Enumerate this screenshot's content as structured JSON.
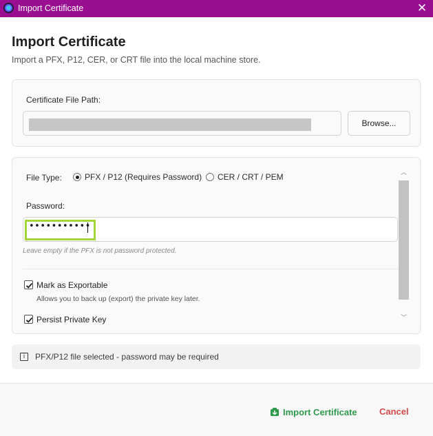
{
  "window": {
    "title": "Import Certificate",
    "close_glyph": "✕",
    "app_icon": "app-logo-icon"
  },
  "header": {
    "title": "Import Certificate",
    "subtitle": "Import a PFX, P12, CER, or CRT file into the local machine store."
  },
  "file_section": {
    "label": "Certificate File Path:",
    "path_value": "",
    "path_redacted": true,
    "browse_label": "Browse..."
  },
  "options": {
    "file_type_label": "File Type:",
    "file_types": [
      {
        "label": "PFX / P12 (Requires Password)",
        "selected": true
      },
      {
        "label": "CER / CRT / PEM",
        "selected": false
      }
    ],
    "password_label": "Password:",
    "password_masked": "•••••••••••",
    "password_hint": "Leave empty if the PFX is not password protected.",
    "exportable": {
      "label": "Mark as Exportable",
      "checked": true,
      "description": "Allows you to back up (export) the private key later."
    },
    "persist": {
      "label": "Persist Private Key",
      "checked": true
    },
    "scroll_up_glyph": "︿",
    "scroll_down_glyph": "﹀"
  },
  "status": {
    "icon": "info-icon",
    "icon_glyph": "i",
    "text": "PFX/P12 file selected - password may be required"
  },
  "footer": {
    "import_label": "Import Certificate",
    "import_icon": "certificate-import-icon",
    "cancel_label": "Cancel"
  },
  "colors": {
    "titlebar": "#9a0e92",
    "import_green": "#2e9a4c",
    "cancel_red": "#d14a4a",
    "focus_highlight": "#a4d63a"
  }
}
